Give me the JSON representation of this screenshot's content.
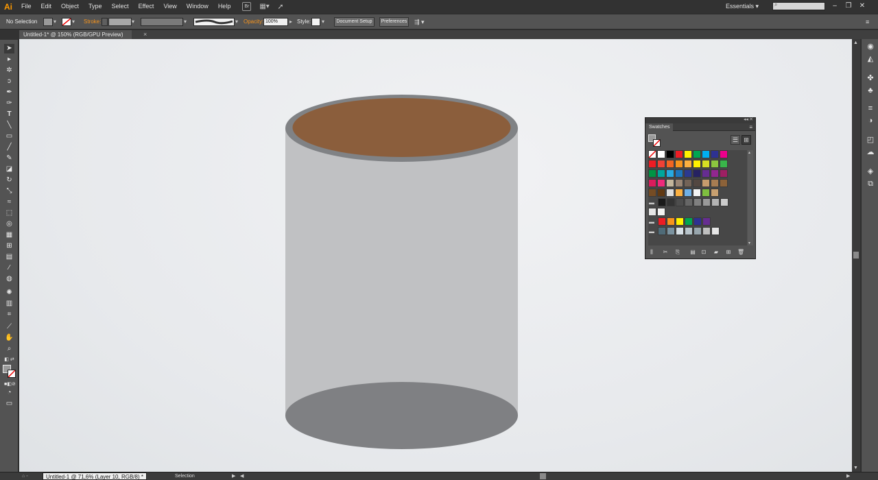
{
  "app": {
    "logo": "Ai",
    "bridge_label": "Br"
  },
  "menu": [
    "File",
    "Edit",
    "Object",
    "Type",
    "Select",
    "Effect",
    "View",
    "Window",
    "Help"
  ],
  "workspace": "Essentials",
  "window_controls": [
    "–",
    "❐",
    "✕"
  ],
  "control_bar": {
    "selection": "No Selection",
    "stroke_label": "Stroke:",
    "opacity_label": "Opacity:",
    "opacity_value": "100%",
    "style_label": "Style:",
    "document_setup": "Document Setup",
    "preferences": "Preferences"
  },
  "document_tab": {
    "title": "Untitled-1* @ 150% (RGB/GPU Preview)",
    "close": "×"
  },
  "status_bar": {
    "zoom_label": "Untitled-1 @ 71,6% (Layer 10, RGB/8) *",
    "tool": "Selection"
  },
  "swatches_panel": {
    "title": "Swatches",
    "rows": [
      [
        "none",
        "#ffffff",
        "#000000",
        "#ed1c24",
        "#fff200",
        "#00a651",
        "#00aeef",
        "#2e3192",
        "#ec008c"
      ],
      [
        "#ed1c24",
        "#ef4136",
        "#f26522",
        "#f7941d",
        "#fbb040",
        "#fff200",
        "#d7df23",
        "#8dc63f",
        "#39b54a"
      ],
      [
        "#009444",
        "#00a79d",
        "#27aae1",
        "#1c75bc",
        "#2b3990",
        "#262262",
        "#662d91",
        "#92278f",
        "#9e1f63"
      ],
      [
        "#da1c5c",
        "#ee2a7b",
        "#c2b59b",
        "#998675",
        "#736357",
        "#534741",
        "#c69c6d",
        "#a67c52",
        "#8c6239"
      ],
      [
        "#754c24",
        "#603913",
        "#dddddd",
        "#fbb040",
        "#6fb0e6",
        "#f4f4f4",
        "#7fbf3f",
        "#c8a070"
      ],
      [
        "#1a1a1a",
        "#333333",
        "#4d4d4d",
        "#666666",
        "#808080",
        "#999999",
        "#b3b3b3",
        "#cccccc"
      ],
      [
        "#e6e6e6",
        "#f2f2f2"
      ],
      [
        "#ed1c24",
        "#f7941d",
        "#fff200",
        "#00a651",
        "#2e3192",
        "#662d91"
      ],
      [
        "#4f6b78",
        "#7b93a0",
        "#d7e0e6",
        "#b8c4cb",
        "#98a6ad",
        "#bfbfbf",
        "#e6e6e6"
      ]
    ]
  },
  "artwork": {
    "cylinder_body": "#c0c1c3",
    "rim": "#808285",
    "liquid": "#8b5e3c",
    "bottom": "#7f8083"
  }
}
